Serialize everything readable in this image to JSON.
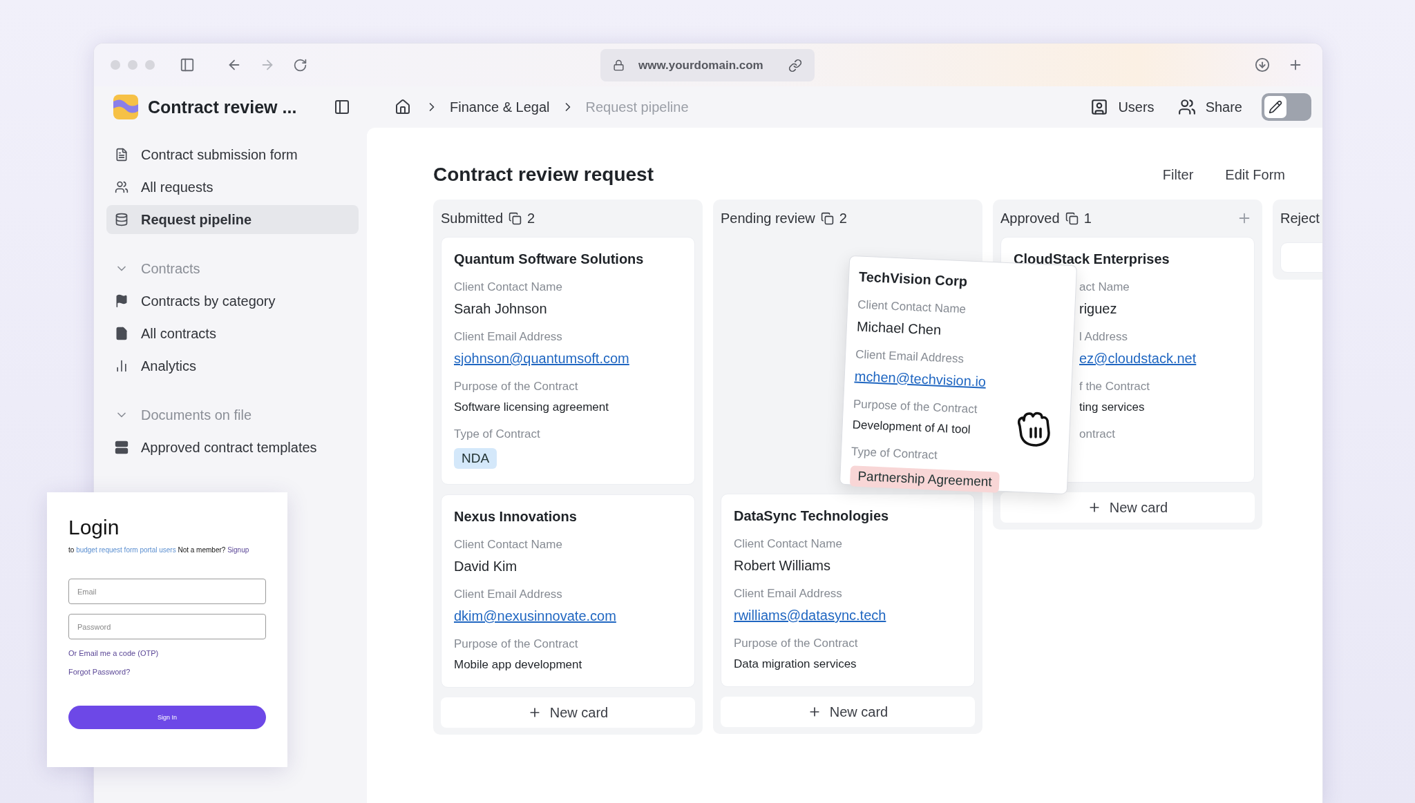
{
  "browser": {
    "url": "www.yourdomain.com"
  },
  "app": {
    "title": "Contract review ..."
  },
  "breadcrumbs": [
    {
      "label": "Finance & Legal",
      "current": false
    },
    {
      "label": "Request pipeline",
      "current": true
    }
  ],
  "header_actions": [
    {
      "label": "Users",
      "kind": "users"
    },
    {
      "label": "Share",
      "kind": "share"
    }
  ],
  "edit_toggle": {
    "on": false
  },
  "sidebar": {
    "items": [
      {
        "label": "Contract submission form",
        "selected": false
      },
      {
        "label": "All requests",
        "selected": false
      },
      {
        "label": "Request pipeline",
        "selected": true
      }
    ],
    "sections": [
      {
        "label": "Contracts",
        "expanded": true,
        "children": [
          {
            "label": "Contracts by category",
            "selected": false
          },
          {
            "label": "All contracts",
            "selected": false
          },
          {
            "label": "Analytics",
            "selected": false
          }
        ]
      },
      {
        "label": "Documents on file",
        "expanded": true,
        "children": [
          {
            "label": "Approved contract templates",
            "selected": false
          }
        ]
      }
    ]
  },
  "board": {
    "title": "Contract review request",
    "actions": [
      "Filter",
      "Edit Form"
    ],
    "columns": [
      {
        "name": "Submitted",
        "count": "2",
        "add_button": false,
        "new_card": "New card",
        "cards": [
          {
            "kind": "card",
            "title": "Quantum Software Solutions",
            "covered_left": false,
            "fields": [
              {
                "label": "Client Contact Name",
                "kind": "name",
                "value": "Sarah Johnson"
              },
              {
                "label": "Client Email Address",
                "kind": "email",
                "value": "sjohnson@quantumsoft.com"
              },
              {
                "label": "Purpose of the Contract",
                "kind": "text",
                "value": "Software licensing agreement"
              },
              {
                "label": "Type of Contract",
                "kind": "tag",
                "value": "NDA",
                "color": "#d4e8fa"
              }
            ]
          },
          {
            "kind": "card",
            "title": "Nexus Innovations",
            "covered_left": false,
            "fields": [
              {
                "label": "Client Contact Name",
                "kind": "name",
                "value": "David Kim"
              },
              {
                "label": "Client Email Address",
                "kind": "email",
                "value": "dkim@nexusinnovate.com"
              },
              {
                "label": "Purpose of the Contract",
                "kind": "text",
                "value": "Mobile app development"
              }
            ]
          }
        ]
      },
      {
        "name": "Pending review",
        "count": "2",
        "add_button": false,
        "new_card": "New card",
        "dragged_card": {
          "title": "TechVision Corp",
          "fields": [
            {
              "label": "Client Contact Name",
              "kind": "name",
              "value": "Michael Chen"
            },
            {
              "label": "Client Email Address",
              "kind": "email",
              "value": "mchen@techvision.io"
            },
            {
              "label": "Purpose of the Contract",
              "kind": "text",
              "value": "Development of AI tool"
            },
            {
              "label": "Type of Contract",
              "kind": "tag",
              "value": "Partnership Agreement",
              "color": "#f8d6d6"
            }
          ]
        },
        "cards": [
          {
            "kind": "drop_slot"
          },
          {
            "kind": "card",
            "title": "DataSync Technologies",
            "covered_left": false,
            "fields": [
              {
                "label": "Client Contact Name",
                "kind": "name",
                "value": "Robert Williams"
              },
              {
                "label": "Client Email Address",
                "kind": "email",
                "value": "rwilliams@datasync.tech"
              },
              {
                "label": "Purpose of the Contract",
                "kind": "text",
                "value": "Data migration services"
              }
            ]
          }
        ]
      },
      {
        "name": "Approved",
        "count": "1",
        "add_button": true,
        "new_card": "New card",
        "cards": [
          {
            "kind": "card",
            "title": "CloudStack Enterprises",
            "covered_left": true,
            "fields": [
              {
                "label": "act Name",
                "kind": "name",
                "value": "riguez"
              },
              {
                "label": "l Address",
                "kind": "email",
                "value": "ez@cloudstack.net"
              },
              {
                "label": "f the Contract",
                "kind": "text",
                "value": "ting services"
              },
              {
                "label": "ontract",
                "kind": "tag"
              }
            ]
          }
        ]
      },
      {
        "name": "Reject",
        "add_button": false,
        "cards": [
          {
            "kind": "stub"
          }
        ]
      }
    ]
  },
  "login": {
    "title": "Login",
    "intro": {
      "prefix": "to",
      "link": "budget request form portal users",
      "middle": "Not a member?",
      "signup": "Signup"
    },
    "email_placeholder": "Email",
    "password_placeholder": "Password",
    "otp_link": "Or Email me a code (OTP)",
    "forgot_link": "Forgot Password?",
    "submit": "Sign In"
  }
}
